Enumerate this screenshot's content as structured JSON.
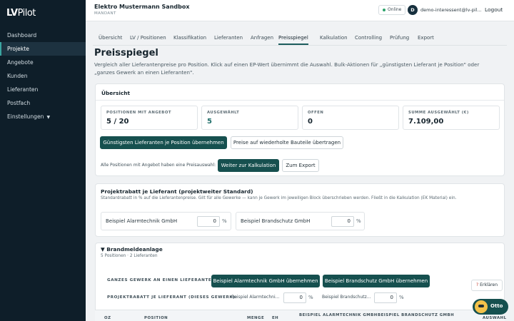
{
  "sidebar": {
    "logo": {
      "lv": "LV",
      "pilot": "Pilot"
    },
    "items": [
      {
        "label": "Dashboard"
      },
      {
        "label": "Projekte"
      },
      {
        "label": "Angebote"
      },
      {
        "label": "Kunden"
      },
      {
        "label": "Lieferanten"
      },
      {
        "label": "Postfach"
      },
      {
        "label": "Einstellungen"
      }
    ],
    "active": "Projekte"
  },
  "topbar": {
    "tenant_name": "Elektro Mustermann Sandbox",
    "tenant_role": "MANDANT",
    "status": "Online",
    "avatar_initial": "D",
    "user": "demo-interessent@lv-pil...",
    "logout": "Logout"
  },
  "tabs": [
    "Übersicht",
    "LV / Positionen",
    "Klassifikation",
    "Lieferanten",
    "Anfragen",
    "Preisspiegel",
    "Kalkulation",
    "Controlling",
    "Prüfung",
    "Export"
  ],
  "active_tab": "Preisspiegel",
  "page": {
    "title": "Preisspiegel",
    "subtitle": "Vergleich aller Lieferantenpreise pro Position. Klick auf einen EP-Wert übernimmt die Auswahl. Bulk-Aktionen für „günstigsten Lieferant je Position\" oder „ganzes Gewerk an einen Lieferanten\"."
  },
  "overview": {
    "title": "Übersicht",
    "stats": [
      {
        "label": "POSITIONEN MIT ANGEBOT",
        "value": "5 / 20"
      },
      {
        "label": "AUSGEWÄHLT",
        "value": "5"
      },
      {
        "label": "OFFEN",
        "value": "0"
      },
      {
        "label": "SUMME AUSGEWÄHLT (€)",
        "value": "7.109,00"
      }
    ],
    "btn_cheapest": "Günstigsten Lieferanten je Position übernehmen",
    "btn_repeat": "Preise auf wiederholte Bauteile übertragen",
    "status_text": "Alle Positionen mit Angebot haben eine Preisauswahl:",
    "btn_next": "Weiter zur Kalkulation",
    "btn_export": "Zum Export"
  },
  "rebate": {
    "title": "Projektrabatt je Lieferant (projektweiter Standard)",
    "hint": "Standardrabatt in % auf die Lieferantenpreise. Gilt für alle Gewerke — kann je Gewerk im jeweiligen Block überschrieben werden. Fließt in die Kalkulation (EK Material) ein.",
    "suppliers": [
      {
        "name": "Beispiel Alarmtechnik GmbH",
        "value": "0",
        "unit": "%"
      },
      {
        "name": "Beispiel Brandschutz GmbH",
        "value": "0",
        "unit": "%"
      }
    ]
  },
  "gewerk": {
    "toggle": "▼",
    "title": "Brandmeldeanlage",
    "sub": "5 Positionen · 2 Lieferanten",
    "assign_label": "GANZES GEWERK AN EINEN LIEFERANTEN:",
    "assign_buttons": [
      "Beispiel Alarmtechnik GmbH übernehmen",
      "Beispiel Brandschutz GmbH übernehmen"
    ],
    "rebate_label": "PROJEKTRABATT JE LIEFERANT (DIESES GEWERK):",
    "rebate_fields": [
      {
        "name": "Beispiel Alarmtechni...",
        "value": "0",
        "unit": "%"
      },
      {
        "name": "Beispiel Brandschutz...",
        "value": "0",
        "unit": "%"
      }
    ],
    "columns": [
      "OZ",
      "POSITION",
      "MENGE",
      "EH",
      "BEISPIEL ALARMTECHNIK GMBH",
      "BEISPIEL BRANDSCHUTZ GMBH",
      "AUSWAHL"
    ]
  },
  "help": {
    "label": "Erklären",
    "icon": "?"
  },
  "assistant": {
    "label": "Otto"
  }
}
